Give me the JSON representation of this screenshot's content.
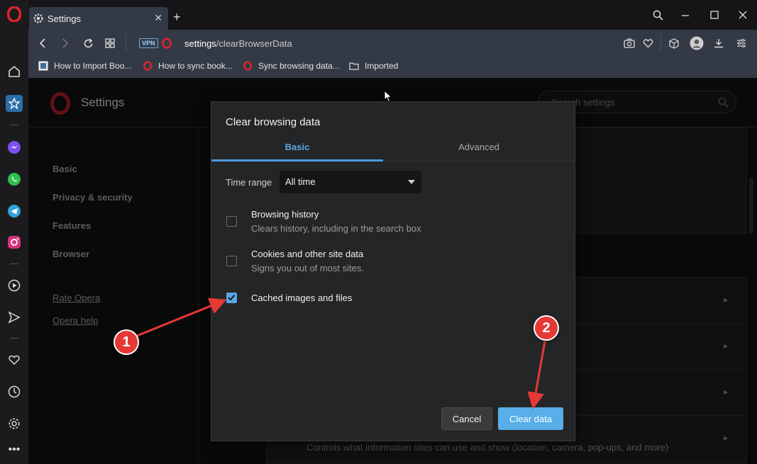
{
  "tab": {
    "title": "Settings",
    "close_glyph": "✕",
    "new_tab_glyph": "+"
  },
  "window_controls": {
    "search": "search-icon",
    "minimize": "minimize-icon",
    "maximize": "maximize-icon",
    "close": "close-icon"
  },
  "address": {
    "host": "settings",
    "path": "/clearBrowserData",
    "vpn_label": "VPN"
  },
  "bookmarks": [
    {
      "label": "How to Import Boo..."
    },
    {
      "label": "How to sync book..."
    },
    {
      "label": "Sync browsing data..."
    },
    {
      "label": "Imported"
    }
  ],
  "settings_page": {
    "title": "Settings",
    "search_placeholder": "Search settings",
    "nav": [
      "Basic",
      "Privacy & security",
      "Features",
      "Browser"
    ],
    "links": [
      "Rate Opera",
      "Opera help"
    ],
    "row_text": "Controls what information sites can use and show (location, camera, pop-ups, and more)"
  },
  "dialog": {
    "title": "Clear browsing data",
    "tabs": [
      {
        "label": "Basic",
        "active": true
      },
      {
        "label": "Advanced",
        "active": false
      }
    ],
    "time_range_label": "Time range",
    "time_range_value": "All time",
    "items": [
      {
        "title": "Browsing history",
        "desc": "Clears history, including in the search box",
        "checked": false
      },
      {
        "title": "Cookies and other site data",
        "desc": "Signs you out of most sites.",
        "checked": false
      },
      {
        "title": "Cached images and files",
        "desc": "",
        "checked": true
      }
    ],
    "cancel_label": "Cancel",
    "clear_label": "Clear data"
  },
  "annotations": {
    "step1": "1",
    "step2": "2"
  },
  "colors": {
    "accent": "#57aee8",
    "annotation_red": "#e53935",
    "opera_red": "#e0232d"
  }
}
